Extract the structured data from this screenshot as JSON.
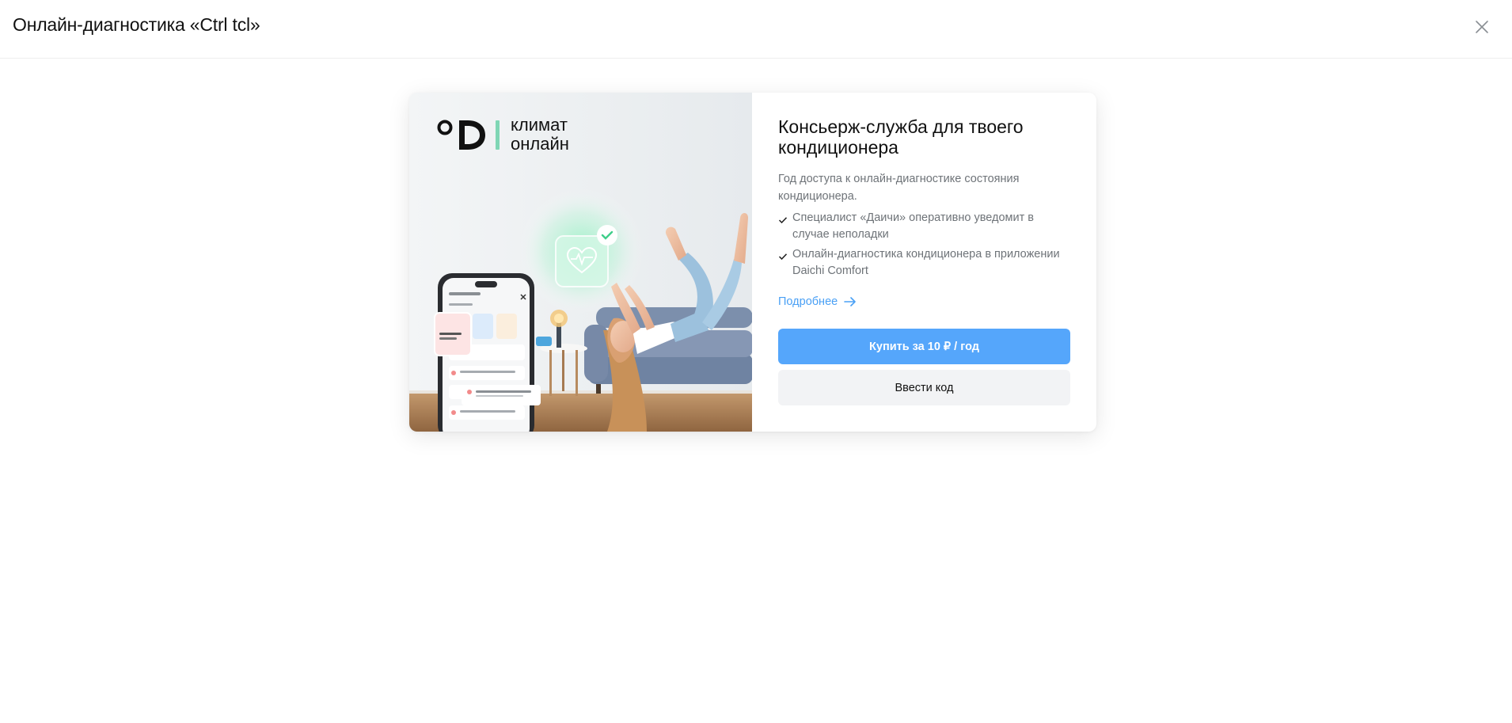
{
  "header": {
    "title": "Онлайн-диагностика «Ctrl tcl»"
  },
  "card": {
    "logo": {
      "line1": "климат",
      "line2": "онлайн"
    },
    "title": "Консьерж-служба для твоего кондиционера",
    "description": "Год доступа к онлайн-диагностике состояния кондиционера.",
    "features": [
      "Специалист «Даичи» оперативно уведомит в случае неполадки",
      "Онлайн-диагностика кондиционера в приложении Daichi Comfort"
    ],
    "more_link": "Подробнее",
    "buy_button": "Купить за 10 ₽ / год",
    "code_button": "Ввести код"
  },
  "colors": {
    "accent": "#55a6fb",
    "link": "#4aa0f5",
    "secondary_button_bg": "#f2f3f5",
    "muted_text": "#6e7378"
  },
  "icons": [
    "close-icon",
    "logo-mark",
    "check-icon",
    "arrow-right-icon",
    "heart-pulse-icon"
  ]
}
